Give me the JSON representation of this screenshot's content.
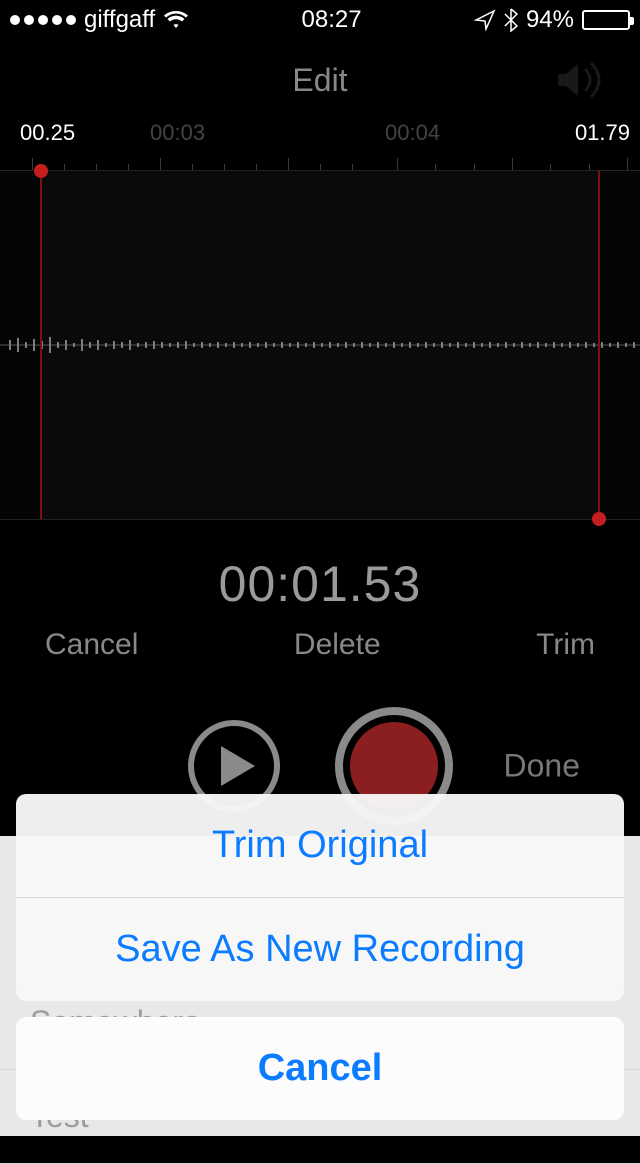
{
  "status": {
    "carrier": "giffgaff",
    "time": "08:27",
    "battery_pct": "94%",
    "battery_fill": 94
  },
  "nav": {
    "title": "Edit"
  },
  "ruler": {
    "start_label": "00.25",
    "mid1_label": "00:03",
    "mid2_label": "00:04",
    "end_label": "01.79"
  },
  "counter": "00:01.53",
  "edit_actions": {
    "cancel": "Cancel",
    "delete": "Delete",
    "trim": "Trim"
  },
  "transport": {
    "done": "Done"
  },
  "list": {
    "item1": "Somewhere",
    "item2": "Test"
  },
  "sheet": {
    "opt1": "Trim Original",
    "opt2": "Save As New Recording",
    "cancel": "Cancel"
  }
}
